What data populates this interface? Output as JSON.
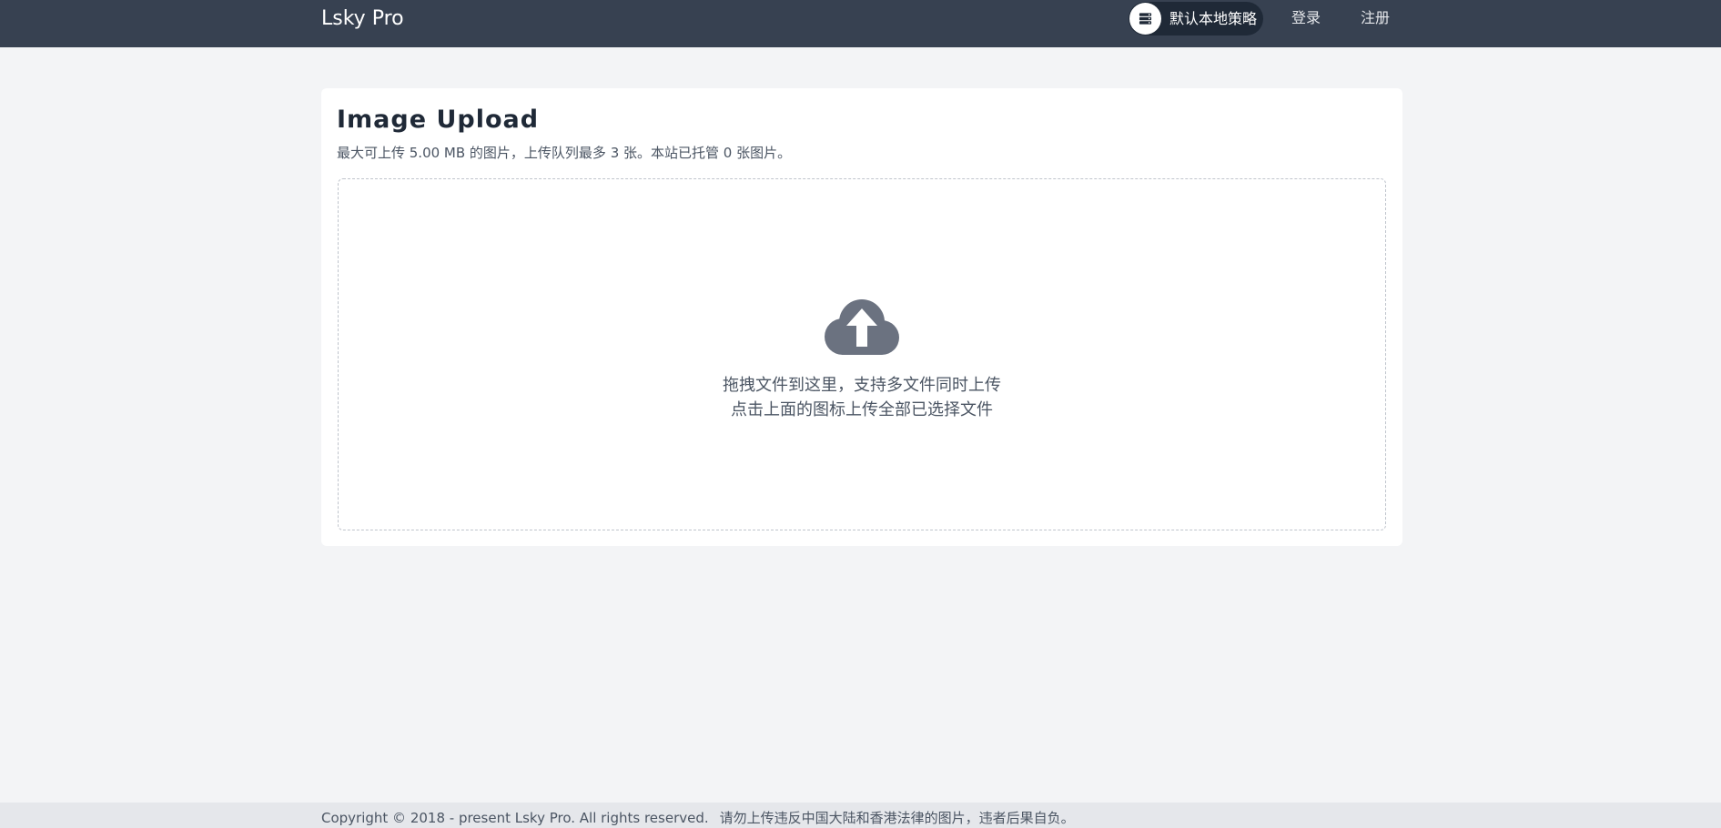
{
  "header": {
    "brand": "Lsky Pro",
    "strategy": {
      "label": "默认本地策略",
      "icon": "server-icon"
    },
    "nav": {
      "login": "登录",
      "register": "注册"
    }
  },
  "upload": {
    "title": "Image Upload",
    "subtitle": "最大可上传 5.00 MB 的图片，上传队列最多 3 张。本站已托管 0 张图片。",
    "icon": "cloud-upload-icon",
    "hint_line1": "拖拽文件到这里，支持多文件同时上传",
    "hint_line2": "点击上面的图标上传全部已选择文件"
  },
  "footer": {
    "copyright": "Copyright © 2018 - present Lsky Pro. All rights reserved.",
    "notice": "请勿上传违反中国大陆和香港法律的图片，违者后果自负。"
  },
  "colors": {
    "topbar": "#374151",
    "page_background": "#f3f4f6",
    "card": "#ffffff",
    "icon": "#6b7280",
    "footer": "#e5e7eb"
  }
}
